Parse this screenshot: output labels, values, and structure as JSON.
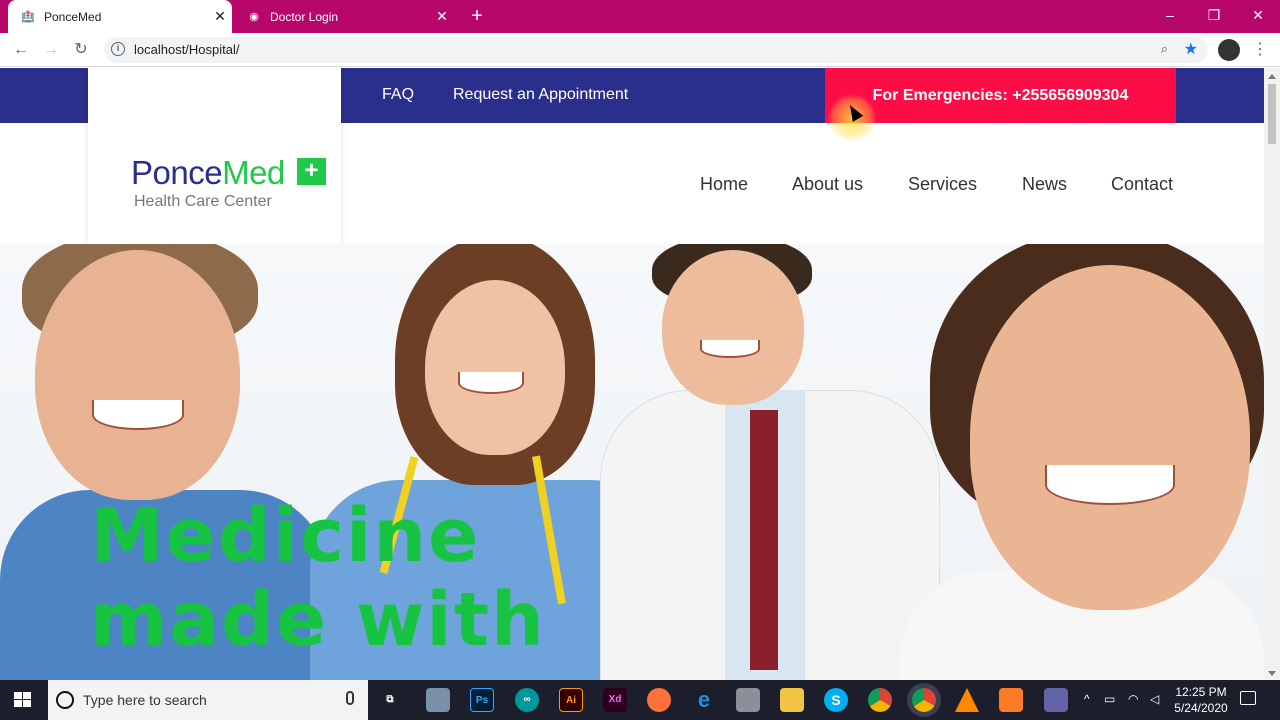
{
  "browser": {
    "tabs": [
      {
        "label": "PonceMed",
        "active": true
      },
      {
        "label": "Doctor Login",
        "active": false
      }
    ],
    "new_tab": "+",
    "url": "localhost/Hospital/",
    "window_controls": {
      "minimize": "–",
      "maximize": "❐",
      "close": "✕"
    }
  },
  "site": {
    "top_links": [
      "FAQ",
      "Request an Appointment"
    ],
    "emergency": "For Emergencies: +255656909304",
    "logo": {
      "part1": "Ponce",
      "part2": "Med",
      "plus": "+",
      "tagline": "Health Care Center"
    },
    "nav": [
      "Home",
      "About us",
      "Services",
      "News",
      "Contact"
    ],
    "hero": {
      "line1": "Medicine",
      "line2": "made with"
    },
    "colors": {
      "navy": "#2b2f8c",
      "green": "#1fc94a",
      "emergency": "#fd0d45"
    }
  },
  "taskbar": {
    "search_placeholder": "Type here to search",
    "apps": [
      {
        "name": "task-view-icon",
        "label": "⧉"
      },
      {
        "name": "network-app-icon",
        "label": ""
      },
      {
        "name": "photoshop-icon",
        "label": "Ps"
      },
      {
        "name": "arduino-icon",
        "label": "∞"
      },
      {
        "name": "illustrator-icon",
        "label": "Ai"
      },
      {
        "name": "xd-icon",
        "label": "Xd"
      },
      {
        "name": "firefox-icon",
        "label": ""
      },
      {
        "name": "edge-icon",
        "label": "e"
      },
      {
        "name": "database-icon",
        "label": ""
      },
      {
        "name": "file-explorer-icon",
        "label": ""
      },
      {
        "name": "skype-icon",
        "label": "S"
      },
      {
        "name": "chrome-icon",
        "label": ""
      },
      {
        "name": "chrome-active-icon",
        "label": ""
      },
      {
        "name": "vlc-icon",
        "label": ""
      },
      {
        "name": "xampp-icon",
        "label": ""
      },
      {
        "name": "teams-icon",
        "label": ""
      }
    ],
    "time": "12:25 PM",
    "date": "5/24/2020"
  }
}
